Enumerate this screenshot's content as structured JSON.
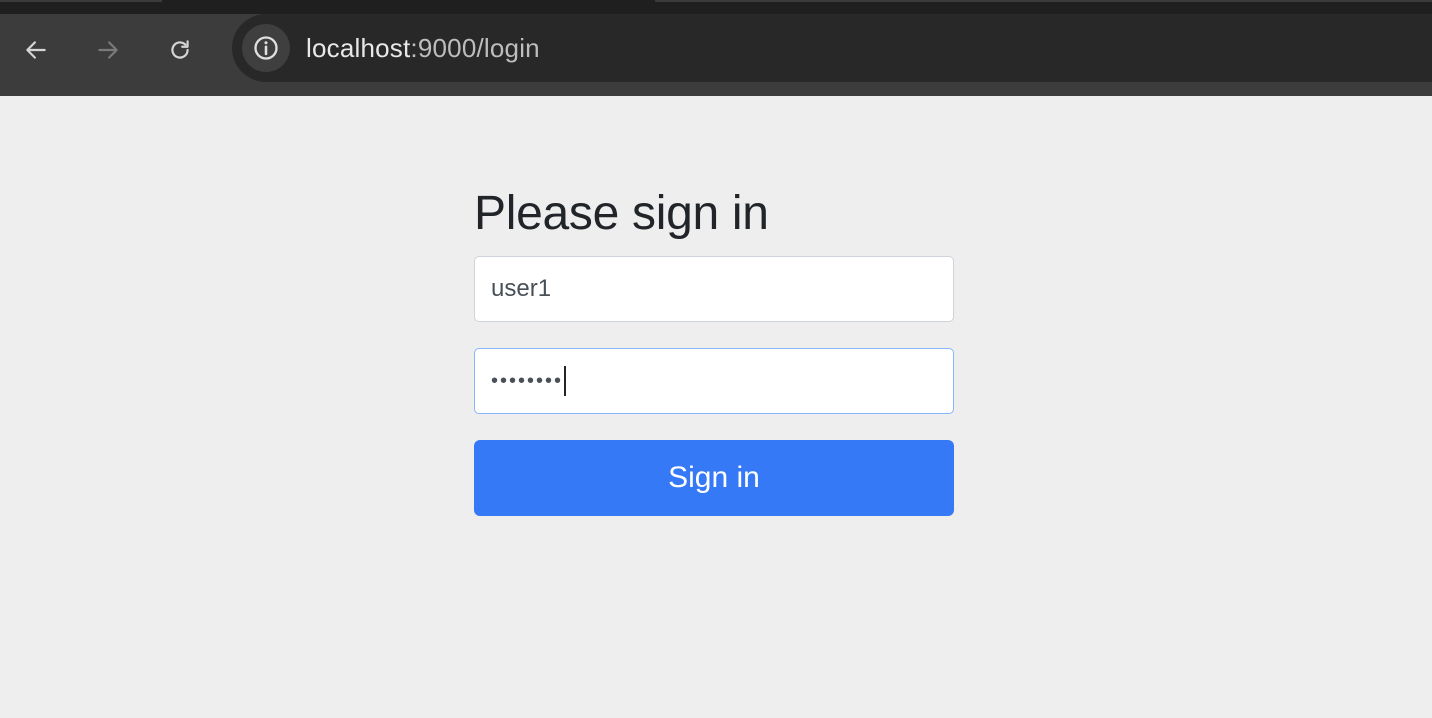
{
  "browser": {
    "url_host": "localhost",
    "url_rest": ":9000/login",
    "icons": {
      "back": "arrow-left-icon",
      "forward": "arrow-right-icon",
      "reload": "reload-icon",
      "site_info": "info-icon"
    },
    "colors": {
      "chrome": "#3c3c3c",
      "omnibox": "#282828",
      "forward_disabled": "#7a7a7a"
    }
  },
  "page": {
    "heading": "Please sign in",
    "username": {
      "value": "user1"
    },
    "password": {
      "masked_value": "••••••••"
    },
    "submit_label": "Sign in",
    "colors": {
      "background": "#eeeeee",
      "primary": "#3579f6",
      "focus_border": "#86b7fe"
    }
  }
}
